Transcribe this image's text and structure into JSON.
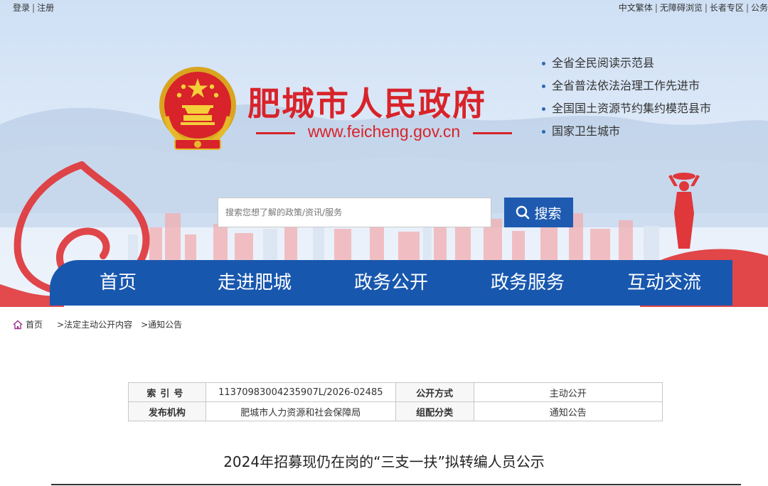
{
  "topbar": {
    "login": "登录",
    "register": "注册",
    "links": [
      "中文繁体",
      "无障碍浏览",
      "长者专区",
      "公务"
    ]
  },
  "site": {
    "title": "肥城市人民政府",
    "url": "www.feicheng.gov.cn"
  },
  "honors": [
    "全省全民阅读示范县",
    "全省普法依法治理工作先进市",
    "全国国土资源节约集约模范县市",
    "国家卫生城市"
  ],
  "search": {
    "placeholder": "搜索您想了解的政策/资讯/服务",
    "button_label": "搜索"
  },
  "nav": [
    "首页",
    "走进肥城",
    "政务公开",
    "政务服务",
    "互动交流"
  ],
  "breadcrumb": {
    "home": "首页",
    "items": [
      ">法定主动公开内容",
      ">通知公告"
    ]
  },
  "info_table": {
    "index_label": "索引号",
    "index_value": "11370983004235907L/2026-02485",
    "method_label": "公开方式",
    "method_value": "主动公开",
    "publisher_label": "发布机构",
    "publisher_value": "肥城市人力资源和社会保障局",
    "category_label": "组配分类",
    "category_value": "通知公告"
  },
  "article": {
    "title": "2024年招募现仍在岗的“三支一扶”拟转编人员公示"
  },
  "colors": {
    "brand_red": "#d8232a",
    "nav_blue": "#1857ae",
    "search_blue": "#1e5bb0"
  }
}
